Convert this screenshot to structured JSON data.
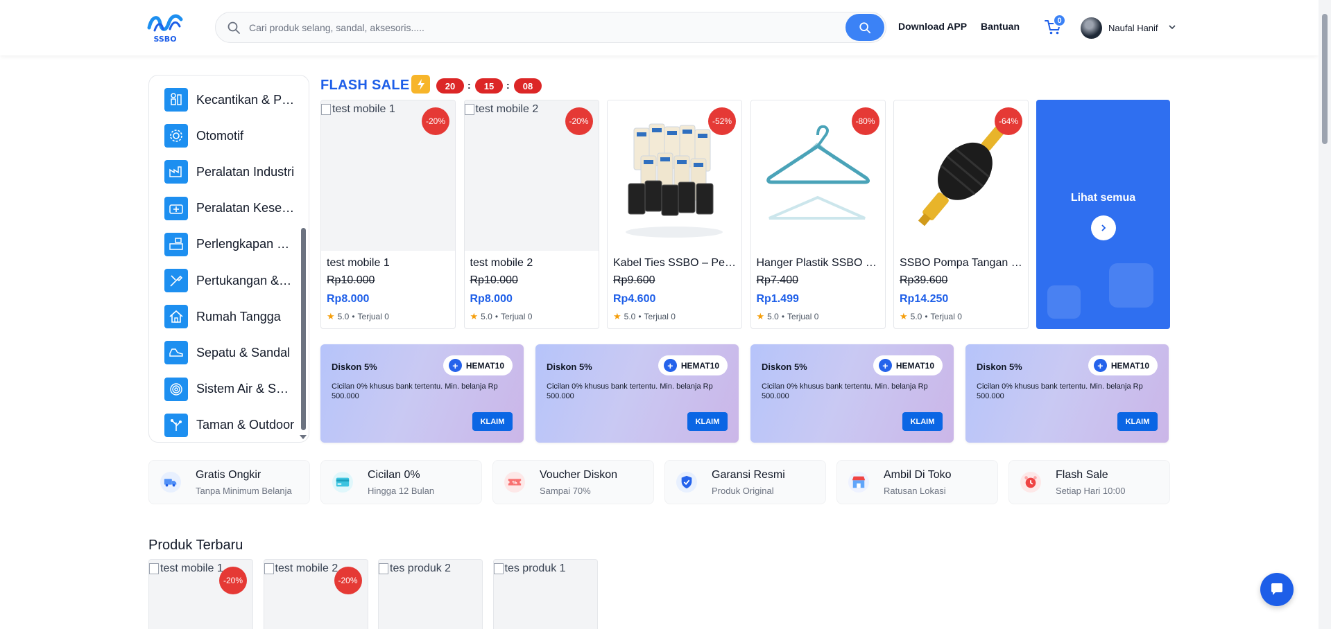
{
  "brand": {
    "logo_text": "SSBO"
  },
  "search": {
    "placeholder": "Cari produk selang, sandal, aksesoris....."
  },
  "header": {
    "download_label": "Download APP",
    "help_label": "Bantuan",
    "cart_count": "0",
    "user_name": "Naufal Hanif"
  },
  "categories": [
    {
      "label": "Kecantikan & Perawatan",
      "icon": "beauty-icon"
    },
    {
      "label": "Otomotif",
      "icon": "gear-icon"
    },
    {
      "label": "Peralatan Industri",
      "icon": "industry-icon"
    },
    {
      "label": "Peralatan Kesehatan",
      "icon": "health-icon"
    },
    {
      "label": "Perlengkapan Kantor",
      "icon": "office-icon"
    },
    {
      "label": "Pertukangan & Perkakas",
      "icon": "tools-icon"
    },
    {
      "label": "Rumah Tangga",
      "icon": "house-icon"
    },
    {
      "label": "Sepatu & Sandal",
      "icon": "shoe-icon"
    },
    {
      "label": "Sistem Air & Selang",
      "icon": "hose-icon"
    },
    {
      "label": "Taman & Outdoor",
      "icon": "garden-icon"
    }
  ],
  "flash_sale": {
    "title": "FLASH SALE",
    "timer": {
      "hours": "20",
      "minutes": "15",
      "seconds": "08"
    },
    "see_all_label": "Lihat semua",
    "products": [
      {
        "alt": "test mobile 1",
        "name": "test mobile 1",
        "old_price": "Rp10.000",
        "new_price": "Rp8.000",
        "discount": "-20%",
        "rating": "5.0",
        "sold": "Terjual 0",
        "image": "broken"
      },
      {
        "alt": "test mobile 2",
        "name": "test mobile 2",
        "old_price": "Rp10.000",
        "new_price": "Rp8.000",
        "discount": "-20%",
        "rating": "5.0",
        "sold": "Terjual 0",
        "image": "broken"
      },
      {
        "alt": "",
        "name": "Kabel Ties SSBO – Pengikat Kabel",
        "old_price": "Rp9.600",
        "new_price": "Rp4.600",
        "discount": "-52%",
        "rating": "5.0",
        "sold": "Terjual 0",
        "image": "cable-ties"
      },
      {
        "alt": "",
        "name": "Hanger Plastik SSBO – Gantungan Baju",
        "old_price": "Rp7.400",
        "new_price": "Rp1.499",
        "discount": "-80%",
        "rating": "5.0",
        "sold": "Terjual 0",
        "image": "hanger"
      },
      {
        "alt": "",
        "name": "SSBO Pompa Tangan Minyak",
        "old_price": "Rp39.600",
        "new_price": "Rp14.250",
        "discount": "-64%",
        "rating": "5.0",
        "sold": "Terjual 0",
        "image": "pump"
      }
    ]
  },
  "vouchers": [
    {
      "title": "Diskon 5%",
      "code": "HEMAT10",
      "desc": "Cicilan 0% khusus bank tertentu. Min. belanja Rp 500.000",
      "button": "KLAIM"
    },
    {
      "title": "Diskon 5%",
      "code": "HEMAT10",
      "desc": "Cicilan 0% khusus bank tertentu. Min. belanja Rp 500.000",
      "button": "KLAIM"
    },
    {
      "title": "Diskon 5%",
      "code": "HEMAT10",
      "desc": "Cicilan 0% khusus bank tertentu. Min. belanja Rp 500.000",
      "button": "KLAIM"
    },
    {
      "title": "Diskon 5%",
      "code": "HEMAT10",
      "desc": "Cicilan 0% khusus bank tertentu. Min. belanja Rp 500.000",
      "button": "KLAIM"
    }
  ],
  "features": [
    {
      "title": "Gratis Ongkir",
      "sub": "Tanpa Minimum Belanja",
      "icon": "truck-icon"
    },
    {
      "title": "Cicilan 0%",
      "sub": "Hingga 12 Bulan",
      "icon": "credit-card-icon"
    },
    {
      "title": "Voucher Diskon",
      "sub": "Sampai 70%",
      "icon": "voucher-icon"
    },
    {
      "title": "Garansi Resmi",
      "sub": "Produk Original",
      "icon": "shield-icon"
    },
    {
      "title": "Ambil Di Toko",
      "sub": "Ratusan Lokasi",
      "icon": "store-icon"
    },
    {
      "title": "Flash Sale",
      "sub": "Setiap Hari 10:00",
      "icon": "alarm-icon"
    }
  ],
  "latest": {
    "title": "Produk Terbaru",
    "products": [
      {
        "alt": "test mobile 1",
        "discount": "-20%"
      },
      {
        "alt": "test mobile 2",
        "discount": "-20%"
      },
      {
        "alt": "tes produk 2",
        "discount": ""
      },
      {
        "alt": "tes produk 1",
        "discount": ""
      }
    ]
  },
  "colors": {
    "primary": "#1d5ee8",
    "accent": "#3b82f6",
    "discount": "#e53935",
    "bolt": "#f7b52a"
  }
}
